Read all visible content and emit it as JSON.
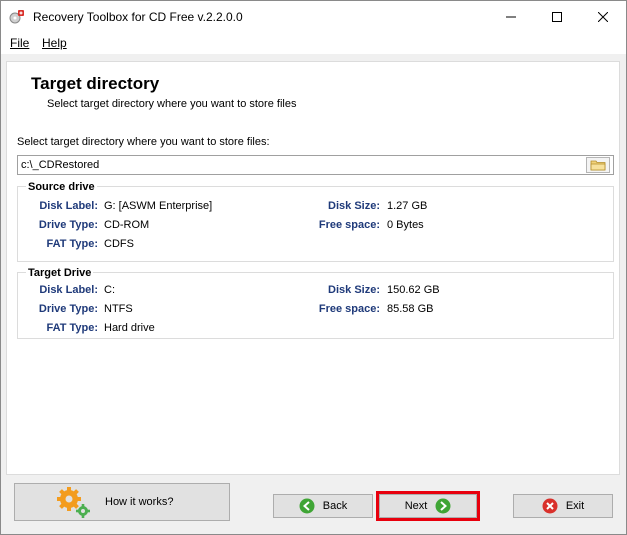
{
  "window": {
    "title": "Recovery Toolbox for CD Free v.2.2.0.0"
  },
  "menu": {
    "file": "File",
    "help": "Help"
  },
  "page": {
    "heading": "Target directory",
    "subheading": "Select target directory where you want to store files",
    "prompt": "Select target directory where you want to store files:",
    "path_value": "c:\\_CDRestored"
  },
  "source_drive": {
    "title": "Source drive",
    "disk_label_label": "Disk Label:",
    "disk_label_value": "G: [ASWM Enterprise]",
    "drive_type_label": "Drive Type:",
    "drive_type_value": "CD-ROM",
    "fat_type_label": "FAT Type:",
    "fat_type_value": "CDFS",
    "disk_size_label": "Disk Size:",
    "disk_size_value": "1.27 GB",
    "free_space_label": "Free space:",
    "free_space_value": "0 Bytes"
  },
  "target_drive": {
    "title": "Target Drive",
    "disk_label_label": "Disk Label:",
    "disk_label_value": "C:",
    "drive_type_label": "Drive Type:",
    "drive_type_value": "NTFS",
    "fat_type_label": "FAT Type:",
    "fat_type_value": "Hard drive",
    "disk_size_label": "Disk Size:",
    "disk_size_value": "150.62 GB",
    "free_space_label": "Free space:",
    "free_space_value": "85.58 GB"
  },
  "buttons": {
    "how_it_works": "How it works?",
    "back": "Back",
    "next": "Next",
    "exit": "Exit"
  },
  "colors": {
    "label_blue": "#1f3a7a",
    "highlight_red": "#e8000d",
    "nav_green": "#3fa535",
    "exit_red": "#d9302b",
    "gear_orange": "#f39c1e",
    "gear_green": "#4caf50"
  },
  "icons": {
    "app": "app-icon",
    "minimize": "minimize-icon",
    "maximize": "maximize-icon",
    "close": "close-icon",
    "browse": "folder-icon",
    "how_it_works": "gears-icon",
    "back": "arrow-left-icon",
    "next": "arrow-right-icon",
    "exit": "exit-x-icon"
  }
}
